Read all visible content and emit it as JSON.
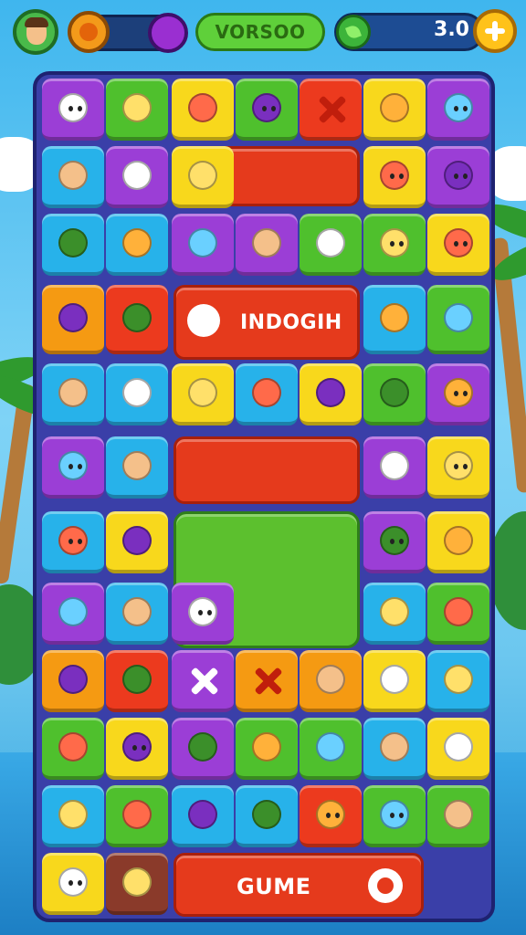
{
  "hud": {
    "title": "VORSOO",
    "coins": "3.0",
    "avatar_icon": "player-avatar-icon",
    "booster_icon": "orange-orb-icon",
    "power_icon": "purple-orb-icon",
    "coin_icon": "leaf-coin-icon",
    "plus_icon": "plus-icon"
  },
  "banners": {
    "row4": "INDOGIH",
    "bottom": "GUME"
  },
  "colors": {
    "board": "#3a3fa8",
    "purple": "#9b3ed6",
    "green": "#4fc02d",
    "yellow": "#f8d81c",
    "red": "#ec3a1e",
    "blue": "#27b2ea",
    "orange": "#f59a12"
  },
  "tiles": [
    {
      "color": "purple",
      "icon": "smiley-face-icon"
    },
    {
      "color": "green",
      "icon": "radish-icon"
    },
    {
      "color": "yellow",
      "icon": "broccoli-icon"
    },
    {
      "color": "green",
      "icon": "purple-monster-icon"
    },
    {
      "color": "red",
      "icon": "cross-icon"
    },
    {
      "color": "yellow",
      "icon": "mango-icon"
    },
    {
      "color": "purple",
      "icon": "yellow-face-icon"
    },
    {
      "color": "blue",
      "icon": "sunflower-icon"
    },
    {
      "color": "purple",
      "icon": "crayon-icon"
    },
    {
      "color": "yellow",
      "icon": "brush-icon"
    },
    {
      "color": "yellow",
      "icon": "redhead-girl-icon"
    },
    {
      "color": "purple",
      "icon": "cowgirl-icon"
    },
    {
      "color": "blue",
      "icon": "flower-icon"
    },
    {
      "color": "blue",
      "icon": "cheese-icon"
    },
    {
      "color": "purple",
      "icon": "house-icon"
    },
    {
      "color": "purple",
      "icon": "sun-icon"
    },
    {
      "color": "green",
      "icon": "lemon-icon"
    },
    {
      "color": "green",
      "icon": "blue-kid-icon"
    },
    {
      "color": "yellow",
      "icon": "dark-hair-girl-icon"
    },
    {
      "color": "orange",
      "icon": "pot-icon"
    },
    {
      "color": "red",
      "icon": "acorn-icon"
    },
    {
      "color": "blue",
      "icon": "apple-icon"
    },
    {
      "color": "green",
      "icon": "plant-icon"
    },
    {
      "color": "blue",
      "icon": "cone-icon"
    },
    {
      "color": "blue",
      "icon": "eraser-icon"
    },
    {
      "color": "yellow",
      "icon": "hammer-icon"
    },
    {
      "color": "blue",
      "icon": "boot-icon"
    },
    {
      "color": "yellow",
      "icon": "cookie-icon"
    },
    {
      "color": "green",
      "icon": "bucket-icon"
    },
    {
      "color": "purple",
      "icon": "curly-girl-icon"
    },
    {
      "color": "purple",
      "icon": "blonde-girl-icon"
    },
    {
      "color": "blue",
      "icon": "marker-icon"
    },
    {
      "color": "purple",
      "icon": "globe-icon"
    },
    {
      "color": "yellow",
      "icon": "girl-icon"
    },
    {
      "color": "blue",
      "icon": "green-hair-girl-icon"
    },
    {
      "color": "yellow",
      "icon": "bell-icon"
    },
    {
      "color": "purple",
      "icon": "sun-face-icon"
    },
    {
      "color": "yellow",
      "icon": "jar-icon"
    },
    {
      "color": "purple",
      "icon": "plum-icon"
    },
    {
      "color": "blue",
      "icon": "ring-icon"
    },
    {
      "color": "purple",
      "icon": "pink-girl-icon"
    },
    {
      "color": "blue",
      "icon": "melon-icon"
    },
    {
      "color": "green",
      "icon": "pepper-icon"
    },
    {
      "color": "orange",
      "icon": "pencil-icon"
    },
    {
      "color": "red",
      "icon": "leaf-icon"
    },
    {
      "color": "purple",
      "icon": "cross-icon"
    },
    {
      "color": "orange",
      "icon": "cross-icon"
    },
    {
      "color": "orange",
      "icon": "grape-icon"
    },
    {
      "color": "yellow",
      "icon": "lime-icon"
    },
    {
      "color": "blue",
      "icon": "apple-icon"
    },
    {
      "color": "green",
      "icon": "popsicle-icon"
    },
    {
      "color": "yellow",
      "icon": "elf-icon"
    },
    {
      "color": "purple",
      "icon": "crayon-icon"
    },
    {
      "color": "green",
      "icon": "tools-icon"
    },
    {
      "color": "green",
      "icon": "zucchini-icon"
    },
    {
      "color": "blue",
      "icon": "apple-icon"
    },
    {
      "color": "yellow",
      "icon": "bread-icon"
    },
    {
      "color": "blue",
      "icon": "palm-icon"
    },
    {
      "color": "green",
      "icon": "tomato-icon"
    },
    {
      "color": "blue",
      "icon": "spoon-icon"
    },
    {
      "color": "blue",
      "icon": "chick-icon"
    },
    {
      "color": "red",
      "icon": "ghost-icon"
    },
    {
      "color": "green",
      "icon": "boy-icon"
    },
    {
      "color": "green",
      "icon": "green-apple-icon"
    },
    {
      "color": "yellow",
      "icon": "cat-icon"
    },
    {
      "color": "brown",
      "icon": "sword-icon"
    }
  ]
}
